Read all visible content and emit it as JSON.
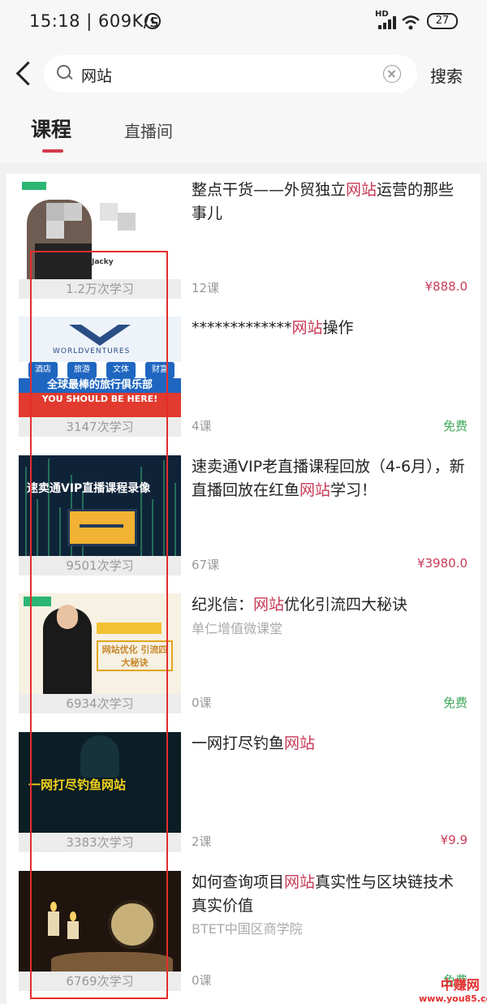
{
  "status_bar": {
    "time": "15:18",
    "separator": "|",
    "network_speed": "609K/s",
    "network_label": "HD",
    "battery": "27"
  },
  "search": {
    "query": "网站",
    "submit_label": "搜索"
  },
  "tabs": [
    {
      "label": "课程",
      "active": true
    },
    {
      "label": "直播间",
      "active": false
    }
  ],
  "accent_color": "#d4394b",
  "keyword_color": "#c83a57",
  "free_color": "#3fa85a",
  "courses": [
    {
      "title_before": "整点干货——外贸独立",
      "title_keyword": "网站",
      "title_after": "运营的那些事儿",
      "subtitle": "",
      "study_count": "1.2万次学习",
      "lesson_count": "12课",
      "price": "¥888.0",
      "thumb_text": "Jacky"
    },
    {
      "title_before": "*************",
      "title_keyword": "网站",
      "title_after": "操作",
      "subtitle": "",
      "study_count": "3147次学习",
      "lesson_count": "4课",
      "price": "免费",
      "thumb_text": "WORLDVENTURES",
      "thumb_pills": [
        "酒店",
        "旅游",
        "文体",
        "财富"
      ],
      "thumb_band": "全球最棒的旅行俱乐部",
      "thumb_band2": "YOU SHOULD BE HERE!"
    },
    {
      "title_before": "速卖通VIP老直播课程回放（4-6月），新直播回放在红鱼",
      "title_keyword": "网站",
      "title_after": "学习！",
      "subtitle": "",
      "study_count": "9501次学习",
      "lesson_count": "67课",
      "price": "¥3980.0",
      "thumb_text": "速卖通VIP直播课程录像"
    },
    {
      "title_before": "纪兆信：",
      "title_keyword": "网站",
      "title_after": "优化引流四大秘诀",
      "subtitle": "单仁增值微课堂",
      "study_count": "6934次学习",
      "lesson_count": "0课",
      "price": "免费",
      "thumb_text": "网站优化 引流四大秘诀"
    },
    {
      "title_before": "一网打尽钓鱼",
      "title_keyword": "网站",
      "title_after": "",
      "subtitle": "",
      "study_count": "3383次学习",
      "lesson_count": "2课",
      "price": "¥9.9",
      "thumb_text": "一网打尽钓鱼网站"
    },
    {
      "title_before": "如何查询项目",
      "title_keyword": "网站",
      "title_after": "真实性与区块链技术真实价值",
      "subtitle": "BTET中国区商学院",
      "study_count": "6769次学习",
      "lesson_count": "0课",
      "price": "免费",
      "thumb_text": ""
    }
  ],
  "watermark": {
    "main": "中赚网",
    "url": "www.you85.com"
  }
}
